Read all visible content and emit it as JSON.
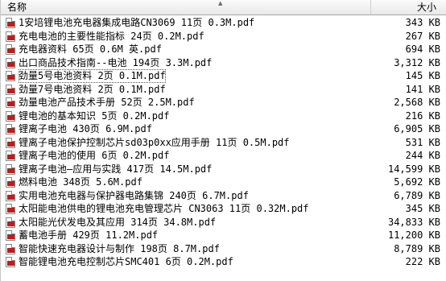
{
  "header": {
    "name_label": "名称",
    "size_label": "大小"
  },
  "files": [
    {
      "name": "1安培锂电池充电器集成电路CN3069 11页 0.3M.pdf",
      "size": "343 KB"
    },
    {
      "name": "充电电池的主要性能指标 24页 0.2M.pdf",
      "size": "267 KB"
    },
    {
      "name": "充电器资料 65页 0.6M 英.pdf",
      "size": "694 KB"
    },
    {
      "name": "出口商品技术指南--电池 194页 3.3M.pdf",
      "size": "3,312 KB"
    },
    {
      "name": "劲量5号电池资料 2页 0.1M.pdf",
      "size": "145 KB"
    },
    {
      "name": "劲量7号电池资料 2页 0.1M.pdf",
      "size": "141 KB"
    },
    {
      "name": "劲量电池产品技术手册 52页 2.5M.pdf",
      "size": "2,568 KB"
    },
    {
      "name": "锂电池的基本知识 5页 0.2M.pdf",
      "size": "216 KB"
    },
    {
      "name": "锂离子电池 430页 6.9M.pdf",
      "size": "6,905 KB"
    },
    {
      "name": "锂离子电池保护控制芯片sd03p0xx应用手册 11页 0.5M.pdf",
      "size": "531 KB"
    },
    {
      "name": "锂离子电池的使用 6页 0.2M.pdf",
      "size": "244 KB"
    },
    {
      "name": "锂离子电池—应用与实践 417页 14.5M.pdf",
      "size": "14,599 KB"
    },
    {
      "name": "燃料电池 348页 5.6M.pdf",
      "size": "5,692 KB"
    },
    {
      "name": "实用电池充电器与保护器电路集锦 240页 6.7M.pdf",
      "size": "6,789 KB"
    },
    {
      "name": "太阳能电池供电的锂电池充电管理芯片 CN3063 11页 0.32M.pdf",
      "size": "345 KB"
    },
    {
      "name": "太阳能光伏发电及其应用 314页 34.8M.pdf",
      "size": "34,833 KB"
    },
    {
      "name": "蓄电池手册 429页 11.2M.pdf",
      "size": "11,200 KB"
    },
    {
      "name": "智能快速充电器设计与制作 198页 8.7M.pdf",
      "size": "8,789 KB"
    },
    {
      "name": "智能锂电池充电控制芯片SMC401 6页 0.2M.pdf",
      "size": "222 KB"
    }
  ]
}
